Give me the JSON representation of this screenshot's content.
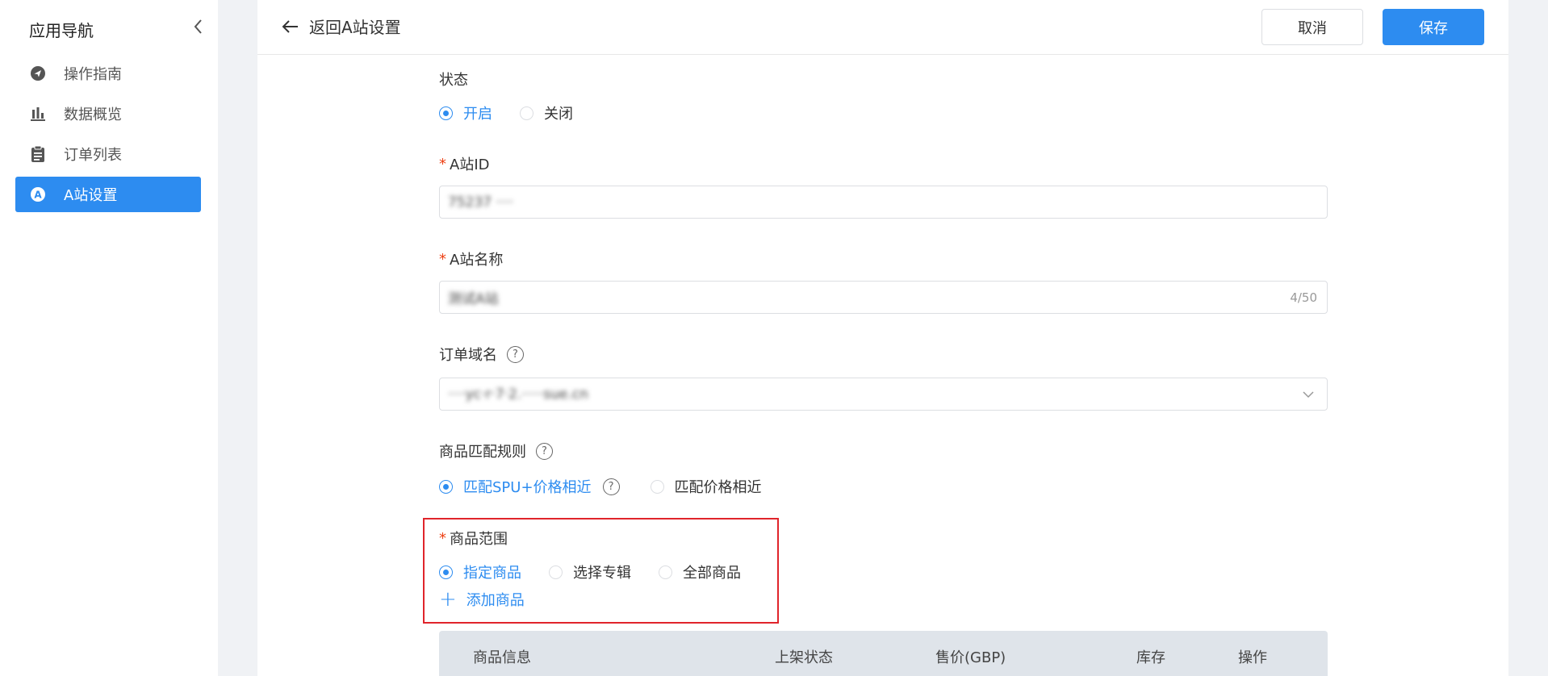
{
  "sidebar": {
    "title": "应用导航",
    "items": [
      {
        "label": "操作指南",
        "icon": "send-icon"
      },
      {
        "label": "数据概览",
        "icon": "bar-chart-icon"
      },
      {
        "label": "订单列表",
        "icon": "clipboard-icon"
      },
      {
        "label": "A站设置",
        "icon": "letter-a-icon",
        "active": true
      }
    ]
  },
  "header": {
    "back_label": "返回A站设置",
    "cancel_label": "取消",
    "save_label": "保存"
  },
  "form": {
    "status": {
      "label": "状态",
      "options": [
        "开启",
        "关闭"
      ],
      "selected": "开启"
    },
    "site_id": {
      "label": "A站ID",
      "value": "75237 ····"
    },
    "site_name": {
      "label": "A站名称",
      "value": "测试A站",
      "counter": "4/50"
    },
    "order_domain": {
      "label": "订单域名",
      "value": "····yc·r·7·2.·····sue.cn"
    },
    "match_rule": {
      "label": "商品匹配规则",
      "options": [
        "匹配SPU+价格相近",
        "匹配价格相近"
      ],
      "selected": "匹配SPU+价格相近"
    },
    "product_scope": {
      "label": "商品范围",
      "options": [
        "指定商品",
        "选择专辑",
        "全部商品"
      ],
      "selected": "指定商品",
      "add_label": "添加商品"
    }
  },
  "table": {
    "columns": [
      "商品信息",
      "上架状态",
      "售价(GBP)",
      "库存",
      "操作"
    ]
  },
  "colors": {
    "accent": "#2d8cf0",
    "required": "#ed4014",
    "highlight_border": "#e0242b"
  }
}
